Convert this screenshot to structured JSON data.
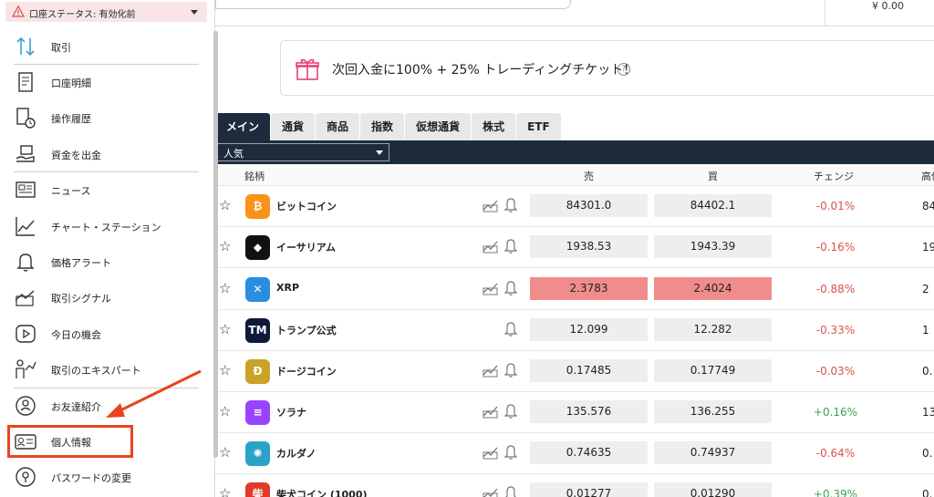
{
  "topbar": {
    "balance": "¥ 0.00"
  },
  "promo": {
    "text": "次回入金に100% + 25% トレーディングチケット！",
    "help": "?"
  },
  "sidebar": {
    "status": "口座ステータス: 有効化前",
    "items": [
      {
        "label": "取引",
        "icon": "trade-arrows-icon"
      },
      {
        "label": "口座明細",
        "icon": "statement-icon"
      },
      {
        "label": "操作履歴",
        "icon": "history-icon"
      },
      {
        "label": "資金を出金",
        "icon": "withdraw-icon"
      },
      {
        "label": "ニュース",
        "icon": "news-icon"
      },
      {
        "label": "チャート・ステーション",
        "icon": "chart-icon"
      },
      {
        "label": "価格アラート",
        "icon": "bell-icon"
      },
      {
        "label": "取引シグナル",
        "icon": "signal-icon"
      },
      {
        "label": "今日の機会",
        "icon": "play-icon"
      },
      {
        "label": "取引のエキスパート",
        "icon": "expert-icon"
      },
      {
        "label": "お友達紹介",
        "icon": "referral-icon"
      },
      {
        "label": "個人情報",
        "icon": "id-card-icon"
      },
      {
        "label": "パスワードの変更",
        "icon": "lock-icon"
      }
    ]
  },
  "tabs": [
    "メイン",
    "通貨",
    "商品",
    "指数",
    "仮想通貨",
    "株式",
    "ETF"
  ],
  "filter": {
    "selected": "人気"
  },
  "table": {
    "headers": {
      "name": "銘柄",
      "sell": "売",
      "buy": "買",
      "change": "チェンジ",
      "high": "高値"
    },
    "rows": [
      {
        "name": "ビットコイン",
        "icon": "bitcoin-icon",
        "icon_text": "₿",
        "color": "#f7931a",
        "sell": "84301.0",
        "buy": "84402.1",
        "change": "-0.01%",
        "high": "84",
        "signal": true
      },
      {
        "name": "イーサリアム",
        "icon": "ethereum-icon",
        "icon_text": "◆",
        "color": "#111111",
        "sell": "1938.53",
        "buy": "1943.39",
        "change": "-0.16%",
        "high": "19",
        "signal": true
      },
      {
        "name": "XRP",
        "icon": "xrp-icon",
        "icon_text": "✕",
        "color": "#2a8ee0",
        "sell": "2.3783",
        "buy": "2.4024",
        "change": "-0.88%",
        "high": "2",
        "signal": true,
        "highlight": true
      },
      {
        "name": "トランプ公式",
        "icon": "trump-icon",
        "icon_text": "TM",
        "color": "#0f1a3a",
        "sell": "12.099",
        "buy": "12.282",
        "change": "-0.33%",
        "high": "1",
        "signal": false
      },
      {
        "name": "ドージコイン",
        "icon": "dogecoin-icon",
        "icon_text": "Đ",
        "color": "#c9a227",
        "sell": "0.17485",
        "buy": "0.17749",
        "change": "-0.03%",
        "high": "0.",
        "signal": true
      },
      {
        "name": "ソラナ",
        "icon": "solana-icon",
        "icon_text": "≡",
        "color": "#9945ff",
        "sell": "135.576",
        "buy": "136.255",
        "change": "+0.16%",
        "high": "13",
        "signal": true
      },
      {
        "name": "カルダノ",
        "icon": "cardano-icon",
        "icon_text": "✺",
        "color": "#29a3c7",
        "sell": "0.74635",
        "buy": "0.74937",
        "change": "-0.64%",
        "high": "0.",
        "signal": true
      },
      {
        "name": "柴犬コイン (1000)",
        "icon": "shiba-icon",
        "icon_text": "柴",
        "color": "#e03a2a",
        "sell": "0.01277",
        "buy": "0.01290",
        "change": "+0.39%",
        "high": "0.",
        "signal": true
      }
    ]
  },
  "colors": {
    "nav_dark": "#1d2b3d",
    "annotation": "#e8451e",
    "sell_highlight": "#f08c8c"
  }
}
